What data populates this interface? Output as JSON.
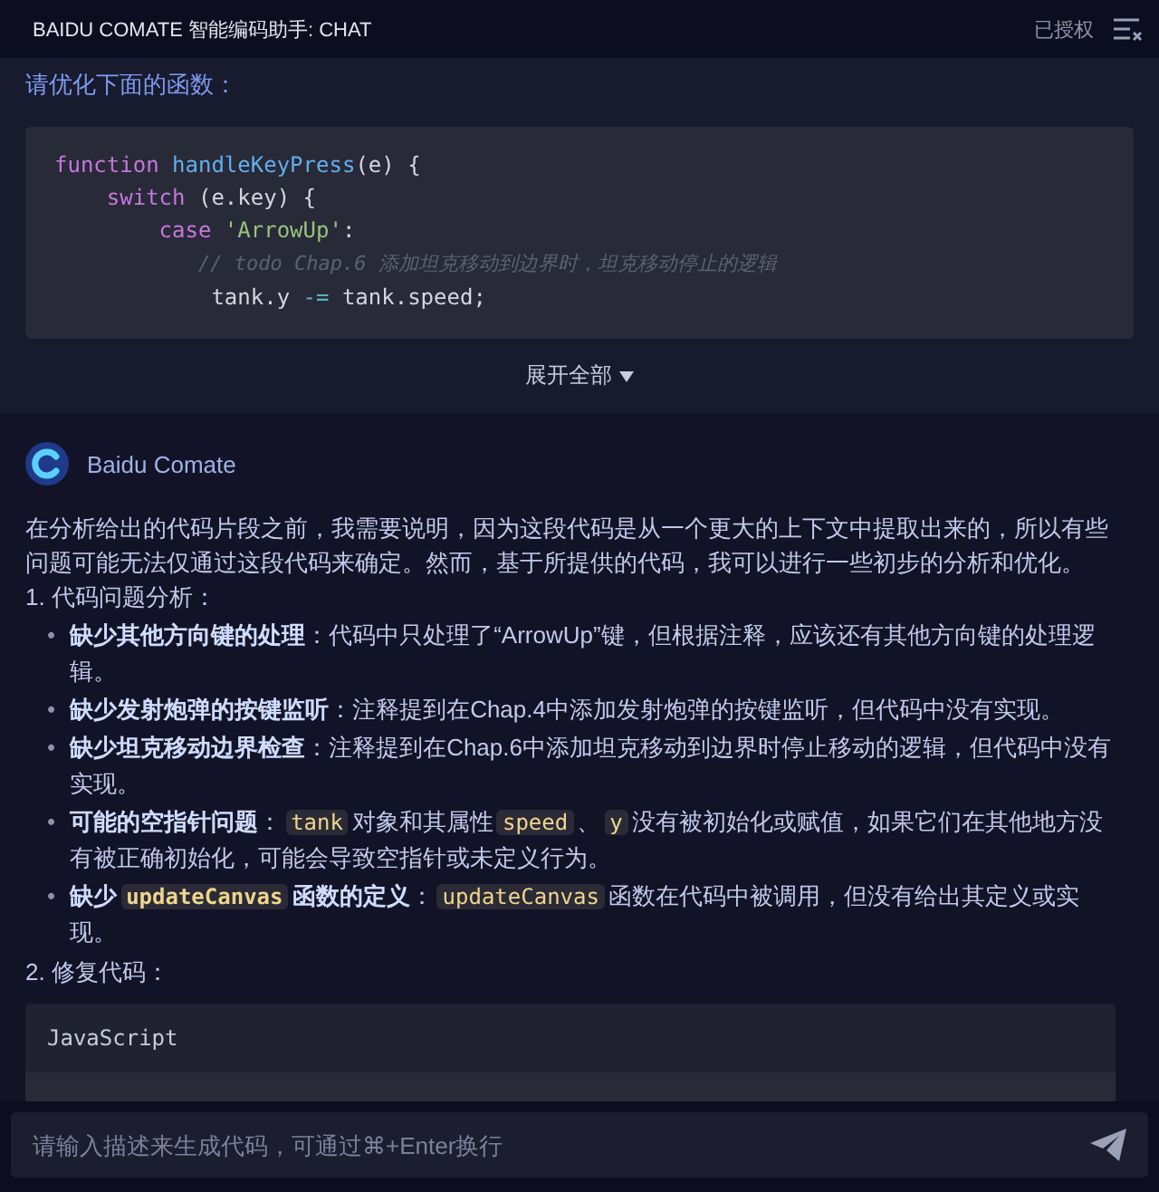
{
  "header": {
    "title": "BAIDU COMATE 智能编码助手: CHAT",
    "license": "已授权"
  },
  "user_message": {
    "prompt": "请优化下面的函数：",
    "code_lines": [
      [
        {
          "kind": "keyword",
          "text": "function "
        },
        {
          "kind": "func",
          "text": "handleKeyPress"
        },
        {
          "kind": "plain",
          "text": "(e) {"
        }
      ],
      [
        {
          "kind": "keyword",
          "text": "    switch"
        },
        {
          "kind": "plain",
          "text": " (e.key) {"
        }
      ],
      [
        {
          "kind": "keyword",
          "text": "        case "
        },
        {
          "kind": "string",
          "text": "'ArrowUp'"
        },
        {
          "kind": "plain",
          "text": ":"
        }
      ],
      [
        {
          "kind": "comment",
          "text": "            // todo Chap.6 添加坦克移动到边界时，坦克移动停止的逻辑"
        }
      ],
      [
        {
          "kind": "plain",
          "text": "            tank.y "
        },
        {
          "kind": "operator",
          "text": "-="
        },
        {
          "kind": "plain",
          "text": " tank.speed;"
        }
      ]
    ],
    "expand": "展开全部"
  },
  "reply": {
    "name": "Baidu Comate",
    "intro": "在分析给出的代码片段之前，我需要说明，因为这段代码是从一个更大的上下文中提取出来的，所以有些问题可能无法仅通过这段代码来确定。然而，基于所提供的代码，我可以进行一些初步的分析和优化。",
    "section_1": "1. 代码问题分析：",
    "bullets": [
      {
        "marker": "•",
        "segments": [
          {
            "kind": "bold",
            "text": "缺少其他方向键的处理"
          },
          {
            "kind": "text",
            "text": "：代码中只处理了“ArrowUp”键，但根据注释，应该还有其他方向键的处理逻辑。"
          }
        ]
      },
      {
        "marker": "•",
        "segments": [
          {
            "kind": "bold",
            "text": "缺少发射炮弹的按键监听"
          },
          {
            "kind": "text",
            "text": "：注释提到在Chap.4中添加发射炮弹的按键监听，但代码中没有实现。"
          }
        ]
      },
      {
        "marker": "•",
        "segments": [
          {
            "kind": "bold",
            "text": "缺少坦克移动边界检查"
          },
          {
            "kind": "text",
            "text": "：注释提到在Chap.6中添加坦克移动到边界时停止移动的逻辑，但代码中没有实现。"
          }
        ]
      },
      {
        "marker": "•",
        "segments": [
          {
            "kind": "bold",
            "text": "可能的空指针问题"
          },
          {
            "kind": "text",
            "text": "："
          },
          {
            "kind": "code",
            "text": "tank"
          },
          {
            "kind": "text",
            "text": "对象和其属性"
          },
          {
            "kind": "code",
            "text": "speed"
          },
          {
            "kind": "text",
            "text": "、"
          },
          {
            "kind": "code",
            "text": "y"
          },
          {
            "kind": "text",
            "text": "没有被初始化或赋值，如果它们在其他地方没有被正确初始化，可能会导致空指针或未定义行为。"
          }
        ]
      },
      {
        "marker": "•",
        "segments": [
          {
            "kind": "bold",
            "text": "缺少"
          },
          {
            "kind": "boldcode",
            "text": "updateCanvas"
          },
          {
            "kind": "bold",
            "text": "函数的定义"
          },
          {
            "kind": "text",
            "text": "："
          },
          {
            "kind": "code",
            "text": "updateCanvas"
          },
          {
            "kind": "text",
            "text": "函数在代码中被调用，但没有给出其定义或实现。"
          }
        ]
      }
    ],
    "section_2": "2. 修复代码：",
    "code_language": "JavaScript"
  },
  "input": {
    "placeholder": "请输入描述来生成代码，可通过⌘+Enter换行"
  }
}
